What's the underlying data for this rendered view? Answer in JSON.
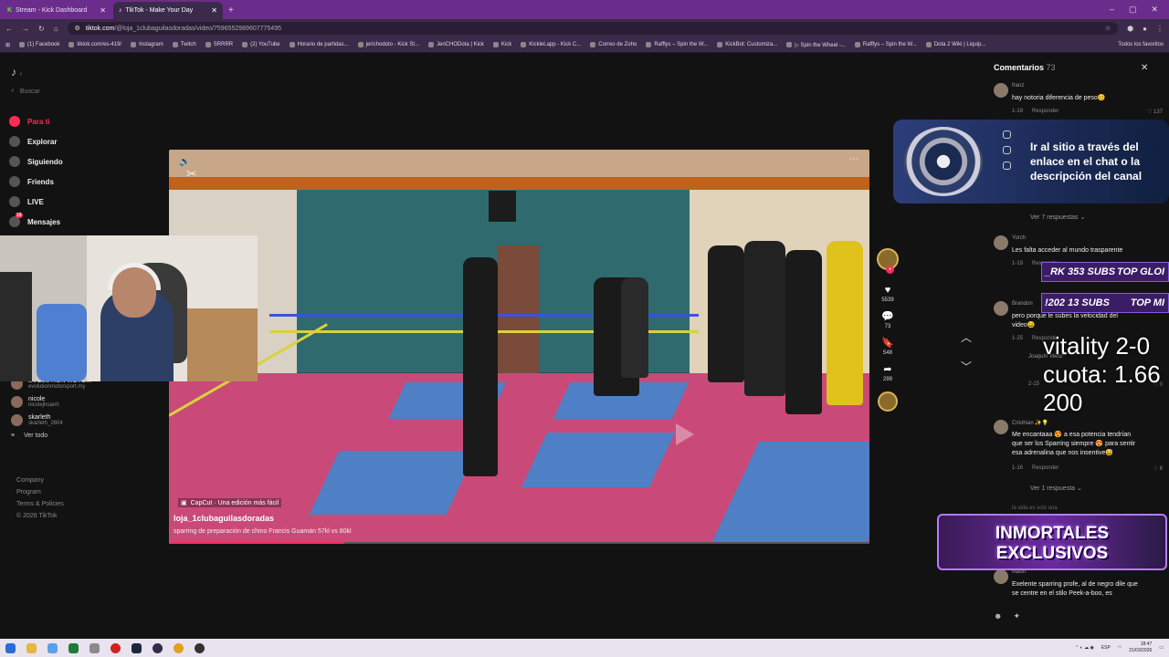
{
  "browser": {
    "tabs": [
      {
        "label": "Stream - Kick Dashboard",
        "active": false
      },
      {
        "label": "TikTok - Make Your Day",
        "active": true
      }
    ],
    "url_domain": "tiktok.com",
    "url_path": "/@loja_1clubaguilasdoradas/video/7596552989607775495",
    "bookmarks": [
      "(1) Facebook",
      "tiktok.com/es-419/",
      "Instagram",
      "Twitch",
      "SRRRR",
      "(2) YouTube",
      "Horario de partidas...",
      "jerichodoto - Kick St...",
      "JeriCHODota | Kick",
      "Kick",
      "Kicklet.app - Kick C...",
      "Correo de Zoho",
      "Rafflys – Spin the W...",
      "KickBot: Customiza...",
      "▷ Spin the Wheel -...",
      "Rafflys – Spin the W...",
      "Dota 2 Wiki | Liquip..."
    ],
    "bookmarks_more": "Todos los favoritos"
  },
  "sidebar": {
    "search_placeholder": "Buscar",
    "nav": [
      {
        "label": "Para ti",
        "active": true
      },
      {
        "label": "Explorar"
      },
      {
        "label": "Siguiendo"
      },
      {
        "label": "Friends"
      },
      {
        "label": "LIVE"
      },
      {
        "label": "Mensajes",
        "badge": "19"
      }
    ],
    "following": [
      {
        "name": "EVOLUTION MOTO...",
        "handle": "evolutionmotorsport.my"
      },
      {
        "name": "nicole",
        "handle": "nicolejhoanh"
      },
      {
        "name": "skarleth",
        "handle": "skarleth_2604"
      }
    ],
    "see_all": "Ver todo",
    "footer": [
      "Company",
      "Program",
      "Terms & Policies",
      "© 2026 TikTok"
    ]
  },
  "video": {
    "capcut_label": "CapCut · Una edición más fácil",
    "username": "loja_1clubaguilasdoradas",
    "description": "sparring de preparación de chino Francis Guamán 57kl vs 80kl",
    "progress": 0.25
  },
  "actions": {
    "likes": "5539",
    "comments": "73",
    "saves": "548",
    "shares": "299"
  },
  "comments_panel": {
    "title": "Comentarios",
    "count": "73",
    "items": [
      {
        "user": "franz",
        "text": "hay notoria diferencia de peso😊",
        "date": "1-19",
        "reply": "Responder",
        "likes": "137"
      },
      {
        "user": "Yorch",
        "text": "Les falta acceder al mundo trasparente",
        "date": "1-19",
        "reply": "Responder"
      },
      {
        "user": "Brandon",
        "text": "pero porque le subes la velocidad del video😄",
        "date": "1-25",
        "reply": "Responder"
      },
      {
        "user": "Joaquín Veloz",
        "text": "",
        "date": "2-15",
        "reply": "Responder",
        "likes": "0"
      },
      {
        "user": "Cristhian ✨💡",
        "text": "Me encantaaa 😍 a esa potencia tendrían que ser los Sparring siempre 😍 para sentir esa adrenalina que nos insentive😅",
        "date": "1-16",
        "reply": "Responder",
        "likes": "6"
      },
      {
        "user": "Mauri",
        "text": "Exelente sparring profe, al de negro dile que se centre en el stilo Peek-a-boo, es",
        "date": "",
        "reply": ""
      }
    ],
    "view_replies_1": "Ver 7 respuestas",
    "view_replies_2": "Ver 1 respuesta",
    "hidden_user": "la vida es solo una"
  },
  "overlays": {
    "roulette_text": "Ir al sitio a través del enlace en el chat o la descripción del canal",
    "subs_1": "_RK 353 SUBS",
    "subs_1_right": "TOP GLOI",
    "subs_2": "!202 13 SUBS",
    "subs_2_right": "TOP MI",
    "bet_line1": "vitality 2-0",
    "bet_line2": "cuota: 1.66",
    "bet_line3": "200",
    "banner_line1": "INMORTALES",
    "banner_line2": "EXCLUSIVOS"
  },
  "taskbar": {
    "lang": "ESP",
    "time": "18:47",
    "date": "21/03/2026"
  }
}
